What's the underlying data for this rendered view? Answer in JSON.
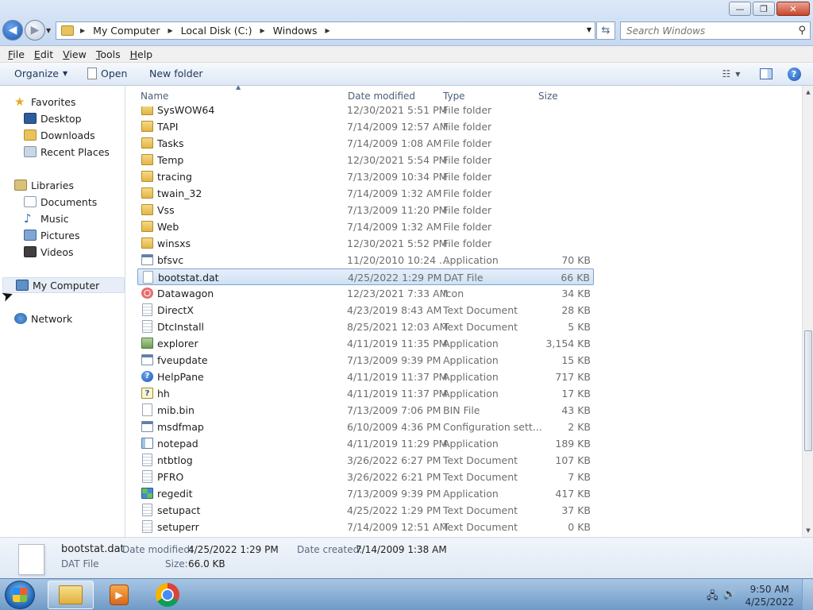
{
  "window": {
    "minimize": "—",
    "maximize": "❐",
    "close": "✕"
  },
  "address": {
    "crumbs": [
      "My Computer",
      "Local Disk (C:)",
      "Windows"
    ],
    "search_placeholder": "Search Windows"
  },
  "menu": [
    "File",
    "Edit",
    "View",
    "Tools",
    "Help"
  ],
  "toolbar": {
    "organize": "Organize",
    "open": "Open",
    "new_folder": "New folder"
  },
  "nav": {
    "favorites": "Favorites",
    "desktop": "Desktop",
    "downloads": "Downloads",
    "recent": "Recent Places",
    "libraries": "Libraries",
    "documents": "Documents",
    "music": "Music",
    "pictures": "Pictures",
    "videos": "Videos",
    "computer": "My Computer",
    "network": "Network"
  },
  "columns": {
    "name": "Name",
    "date": "Date modified",
    "type": "Type",
    "size": "Size"
  },
  "files": [
    {
      "name": "SysWOW64",
      "date": "12/30/2021 5:51 PM",
      "type": "File folder",
      "size": "",
      "icon": "folder-icon"
    },
    {
      "name": "TAPI",
      "date": "7/14/2009 12:57 AM",
      "type": "File folder",
      "size": "",
      "icon": "folder-icon"
    },
    {
      "name": "Tasks",
      "date": "7/14/2009 1:08 AM",
      "type": "File folder",
      "size": "",
      "icon": "folder-icon"
    },
    {
      "name": "Temp",
      "date": "12/30/2021 5:54 PM",
      "type": "File folder",
      "size": "",
      "icon": "folder-icon"
    },
    {
      "name": "tracing",
      "date": "7/13/2009 10:34 PM",
      "type": "File folder",
      "size": "",
      "icon": "folder-icon"
    },
    {
      "name": "twain_32",
      "date": "7/14/2009 1:32 AM",
      "type": "File folder",
      "size": "",
      "icon": "folder-icon"
    },
    {
      "name": "Vss",
      "date": "7/13/2009 11:20 PM",
      "type": "File folder",
      "size": "",
      "icon": "folder-icon"
    },
    {
      "name": "Web",
      "date": "7/14/2009 1:32 AM",
      "type": "File folder",
      "size": "",
      "icon": "folder-icon"
    },
    {
      "name": "winsxs",
      "date": "12/30/2021 5:52 PM",
      "type": "File folder",
      "size": "",
      "icon": "folder-icon"
    },
    {
      "name": "bfsvc",
      "date": "11/20/2010 10:24 ...",
      "type": "Application",
      "size": "70 KB",
      "icon": "app-icon"
    },
    {
      "name": "bootstat.dat",
      "date": "4/25/2022 1:29 PM",
      "type": "DAT File",
      "size": "66 KB",
      "icon": "file-icon",
      "selected": true
    },
    {
      "name": "Datawagon",
      "date": "12/23/2021 7:33 AM",
      "type": "Icon",
      "size": "34 KB",
      "icon": "icon-file-icon"
    },
    {
      "name": "DirectX",
      "date": "4/23/2019 8:43 AM",
      "type": "Text Document",
      "size": "28 KB",
      "icon": "text-icon"
    },
    {
      "name": "DtcInstall",
      "date": "8/25/2021 12:03 AM",
      "type": "Text Document",
      "size": "5 KB",
      "icon": "text-icon"
    },
    {
      "name": "explorer",
      "date": "4/11/2019 11:35 PM",
      "type": "Application",
      "size": "3,154 KB",
      "icon": "explorer-icon"
    },
    {
      "name": "fveupdate",
      "date": "7/13/2009 9:39 PM",
      "type": "Application",
      "size": "15 KB",
      "icon": "app-icon"
    },
    {
      "name": "HelpPane",
      "date": "4/11/2019 11:37 PM",
      "type": "Application",
      "size": "717 KB",
      "icon": "helppane-icon"
    },
    {
      "name": "hh",
      "date": "4/11/2019 11:37 PM",
      "type": "Application",
      "size": "17 KB",
      "icon": "hh-icon"
    },
    {
      "name": "mib.bin",
      "date": "7/13/2009 7:06 PM",
      "type": "BIN File",
      "size": "43 KB",
      "icon": "file-icon"
    },
    {
      "name": "msdfmap",
      "date": "6/10/2009 4:36 PM",
      "type": "Configuration sett...",
      "size": "2 KB",
      "icon": "app-icon"
    },
    {
      "name": "notepad",
      "date": "4/11/2019 11:29 PM",
      "type": "Application",
      "size": "189 KB",
      "icon": "notepad-icon"
    },
    {
      "name": "ntbtlog",
      "date": "3/26/2022 6:27 PM",
      "type": "Text Document",
      "size": "107 KB",
      "icon": "text-icon"
    },
    {
      "name": "PFRO",
      "date": "3/26/2022 6:21 PM",
      "type": "Text Document",
      "size": "7 KB",
      "icon": "text-icon"
    },
    {
      "name": "regedit",
      "date": "7/13/2009 9:39 PM",
      "type": "Application",
      "size": "417 KB",
      "icon": "regedit-icon"
    },
    {
      "name": "setupact",
      "date": "4/25/2022 1:29 PM",
      "type": "Text Document",
      "size": "37 KB",
      "icon": "text-icon"
    },
    {
      "name": "setuperr",
      "date": "7/14/2009 12:51 AM",
      "type": "Text Document",
      "size": "0 KB",
      "icon": "text-icon"
    }
  ],
  "details": {
    "filename": "bootstat.dat",
    "filetype": "DAT File",
    "modified_label": "Date modified:",
    "modified_value": "4/25/2022 1:29 PM",
    "created_label": "Date created:",
    "created_value": "7/14/2009 1:38 AM",
    "size_label": "Size:",
    "size_value": "66.0 KB"
  },
  "taskbar": {
    "time": "9:50 AM",
    "date": "4/25/2022"
  }
}
